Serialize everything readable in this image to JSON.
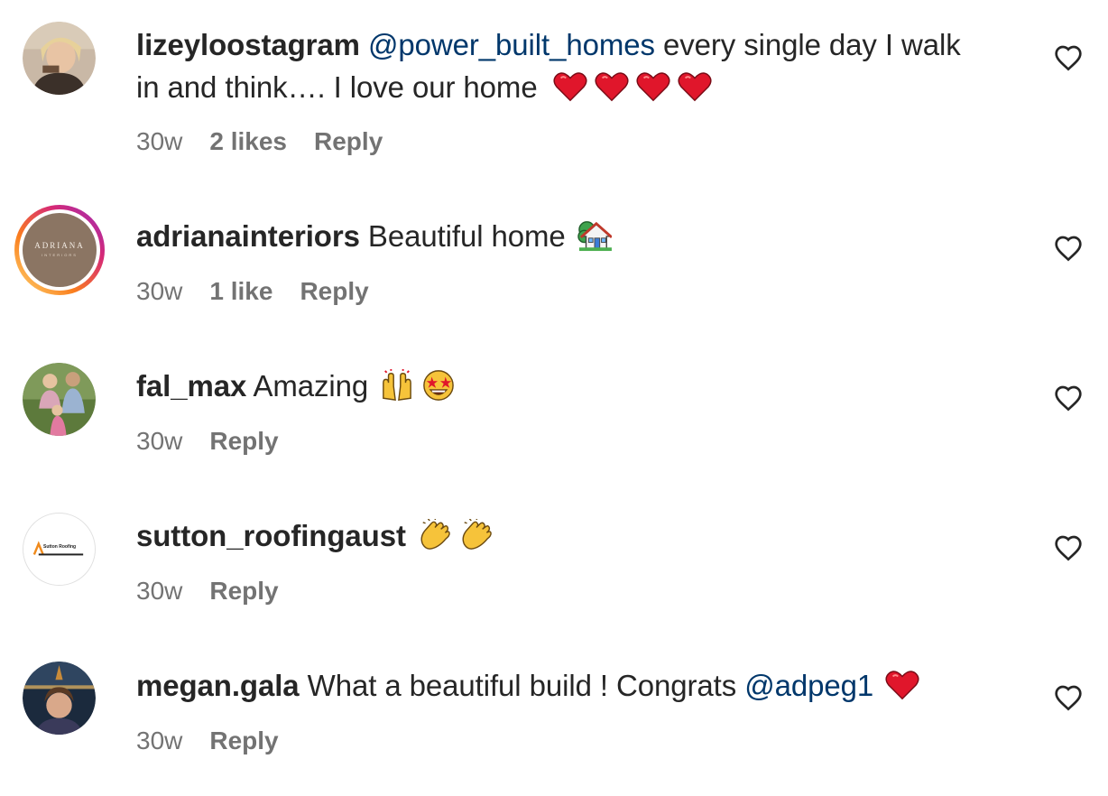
{
  "comments": [
    {
      "username": "lizeyloostagram",
      "mention": "@power_built_homes",
      "text_line1": "every single day I walk",
      "text_line2": "in and think…. I love our home",
      "emojis": [
        "heart-emoji",
        "heart-emoji",
        "heart-emoji",
        "heart-emoji"
      ],
      "time": "30w",
      "likes": "2 likes",
      "reply": "Reply"
    },
    {
      "username": "adrianainteriors",
      "text": "Beautiful home",
      "emojis": [
        "house-with-garden-emoji"
      ],
      "avatar_text": "ADRIANA",
      "avatar_subtext": "INTERIORS",
      "time": "30w",
      "likes": "1 like",
      "reply": "Reply"
    },
    {
      "username": "fal_max",
      "text": "Amazing",
      "emojis": [
        "raising-hands-emoji",
        "star-struck-emoji"
      ],
      "time": "30w",
      "reply": "Reply"
    },
    {
      "username": "sutton_roofingaust",
      "emojis": [
        "clapping-hands-emoji",
        "clapping-hands-emoji"
      ],
      "avatar_text": "Sutton Roofing",
      "time": "30w",
      "reply": "Reply"
    },
    {
      "username": "megan.gala",
      "text": "What a beautiful build ! Congrats",
      "mention": "@adpeg1",
      "emojis": [
        "heart-emoji"
      ],
      "time": "30w",
      "reply": "Reply"
    }
  ],
  "colors": {
    "text": "#262626",
    "secondary": "#737373",
    "mention": "#00376b",
    "heart_emoji": "#e0162b",
    "story_ring_start": "#feda75",
    "story_ring_end": "#d62976"
  },
  "icons": {
    "like_button": "heart-outline-icon"
  }
}
